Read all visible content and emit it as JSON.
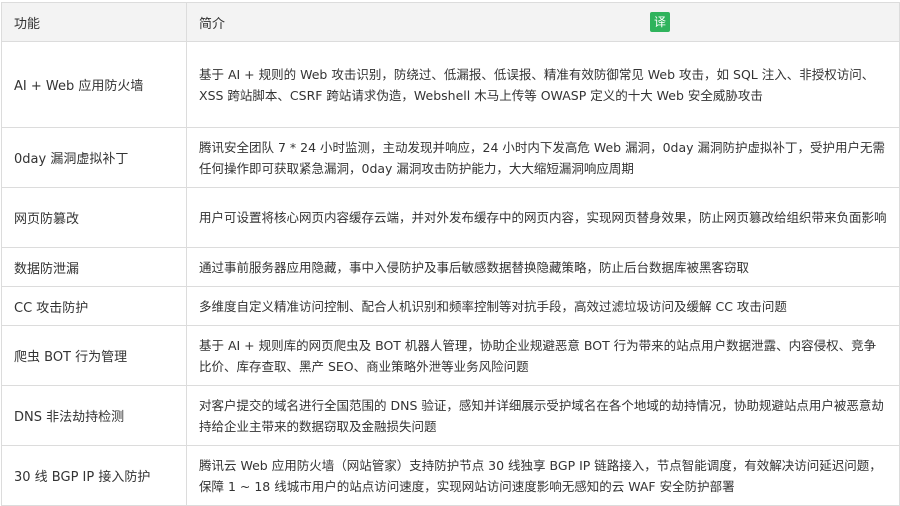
{
  "header": {
    "feature": "功能",
    "intro": "简介",
    "translate": "译"
  },
  "rows": [
    {
      "feature": "AI + Web 应用防火墙",
      "desc": "基于 AI + 规则的 Web 攻击识别，防绕过、低漏报、低误报、精准有效防御常见 Web 攻击，如 SQL 注入、非授权访问、XSS 跨站脚本、CSRF 跨站请求伪造，Webshell 木马上传等 OWASP 定义的十大 Web 安全威胁攻击"
    },
    {
      "feature": "0day 漏洞虚拟补丁",
      "desc": "腾讯安全团队 7 * 24 小时监测，主动发现并响应，24 小时内下发高危 Web 漏洞，0day 漏洞防护虚拟补丁，受护用户无需任何操作即可获取紧急漏洞，0day 漏洞攻击防护能力，大大缩短漏洞响应周期"
    },
    {
      "feature": "网页防篡改",
      "desc": "用户可设置将核心网页内容缓存云端，并对外发布缓存中的网页内容，实现网页替身效果，防止网页篡改给组织带来负面影响"
    },
    {
      "feature": "数据防泄漏",
      "desc": "通过事前服务器应用隐藏，事中入侵防护及事后敏感数据替换隐藏策略，防止后台数据库被黑客窃取"
    },
    {
      "feature": "CC 攻击防护",
      "desc": "多维度自定义精准访问控制、配合人机识别和频率控制等对抗手段，高效过滤垃圾访问及缓解 CC 攻击问题"
    },
    {
      "feature": "爬虫 BOT 行为管理",
      "desc": "基于 AI + 规则库的网页爬虫及 BOT 机器人管理，协助企业规避恶意 BOT 行为带来的站点用户数据泄露、内容侵权、竞争比价、库存查取、黑产 SEO、商业策略外泄等业务风险问题"
    },
    {
      "feature": "DNS 非法劫持检测",
      "desc": "对客户提交的域名进行全国范围的 DNS 验证，感知并详细展示受护域名在各个地域的劫持情况，协助规避站点用户被恶意劫持给企业主带来的数据窃取及金融损失问题"
    },
    {
      "feature": "30 线 BGP IP 接入防护",
      "desc": "腾讯云 Web 应用防火墙（网站管家）支持防护节点 30 线独享 BGP IP 链路接入，节点智能调度，有效解决访问延迟问题，保障 1 ~ 18 线城市用户的站点访问速度，实现网站访问速度影响无感知的云 WAF 安全防护部署"
    }
  ]
}
